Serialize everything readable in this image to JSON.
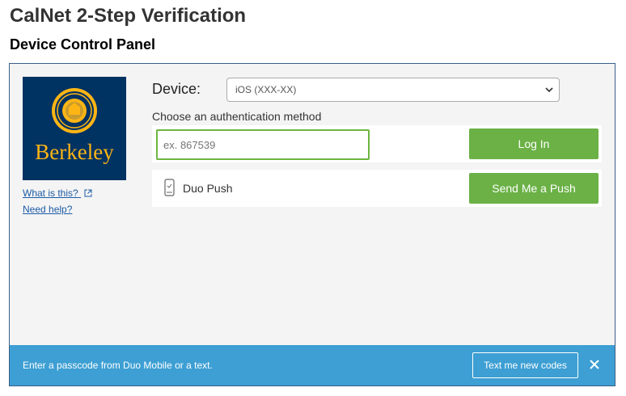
{
  "header": {
    "title": "CalNet 2-Step Verification",
    "subtitle": "Device Control Panel"
  },
  "sidebar": {
    "logo_text": "Berkeley",
    "what_is_this": "What is this?",
    "need_help": "Need help?"
  },
  "device": {
    "label": "Device:",
    "selected": "iOS (XXX-XX)"
  },
  "auth": {
    "method_label": "Choose an authentication method",
    "passcode_placeholder": "ex. 867539",
    "login_label": "Log In",
    "push_label": "Duo Push",
    "push_button": "Send Me a Push"
  },
  "footer": {
    "message": "Enter a passcode from Duo Mobile or a text.",
    "codes_button": "Text me new codes"
  },
  "colors": {
    "brand_navy": "#003262",
    "brand_gold": "#fdb515",
    "accent_green": "#6bb146",
    "footer_blue": "#3d9fd3",
    "link_blue": "#1b5aa6"
  },
  "icons": [
    "uc-seal-icon",
    "external-link-icon",
    "chevron-down-icon",
    "phone-icon",
    "close-icon"
  ]
}
